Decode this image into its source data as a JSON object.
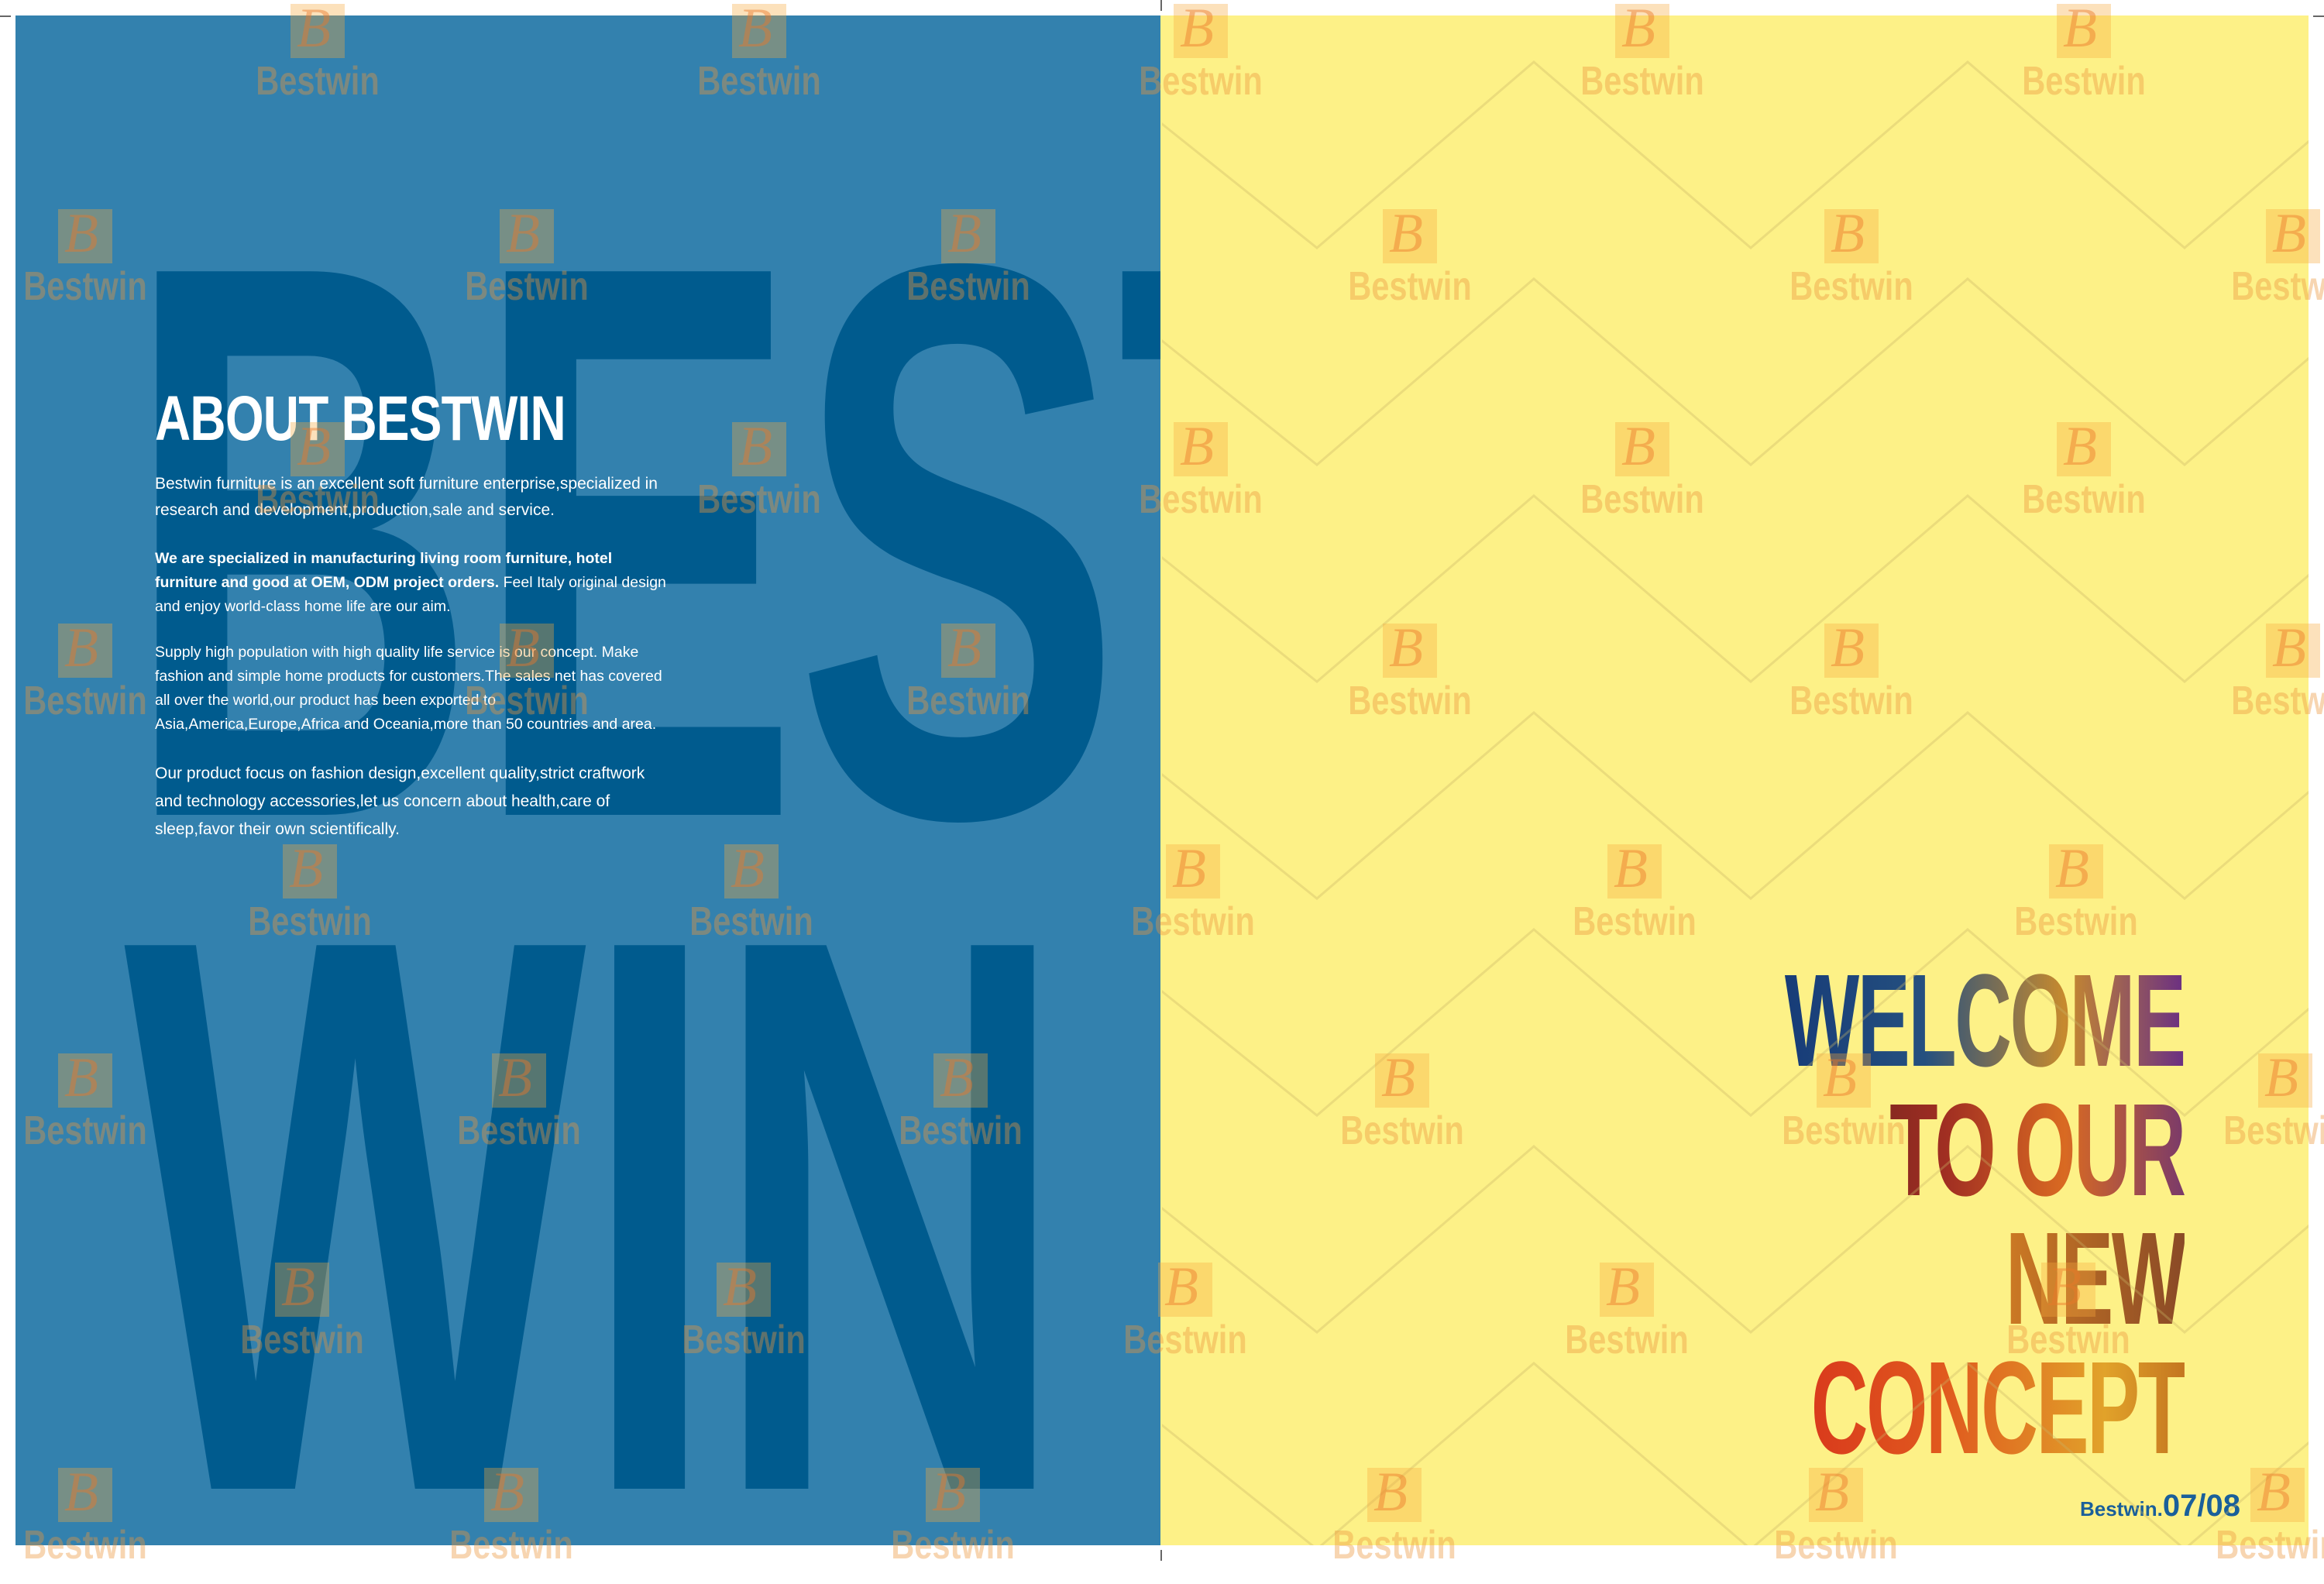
{
  "left_page": {
    "big_word_top": "BEST",
    "big_word_bottom": "WIN",
    "about_title": "ABOUT BESTWIN",
    "paragraph1": "Bestwin furniture is an excellent soft furniture enterprise,specialized in research and development,production,sale and service.",
    "paragraph2_bold": "We are specialized in manufacturing living room furniture, hotel furniture and good at OEM, ODM project orders.",
    "paragraph2_rest": " Feel Italy original design and enjoy world-class home life are our aim.",
    "paragraph3": "Supply high population with high quality life service is our concept. Make fashion and simple home products for customers.The sales net has covered all over the world,our product has been exported to Asia,America,Europe,Africa and Oceania,more than 50 countries and area.",
    "paragraph4": "Our product focus on fashion design,excellent quality,strict craftwork and technology accessories,let us concern about health,care of sleep,favor their own scientifically."
  },
  "right_page": {
    "headline": [
      "WELCOME",
      "TO OUR",
      "NEW",
      "CONCEPT"
    ],
    "brand_small": "Bestwin.",
    "page_numbers": "07/08"
  },
  "watermark": {
    "text": "Bestwin",
    "logo_letter": "B"
  },
  "colors": {
    "left_background": "#3381ae",
    "big_word_color": "#005b8e",
    "right_background": "#fdf187",
    "pager_color": "#1a5f9a"
  }
}
